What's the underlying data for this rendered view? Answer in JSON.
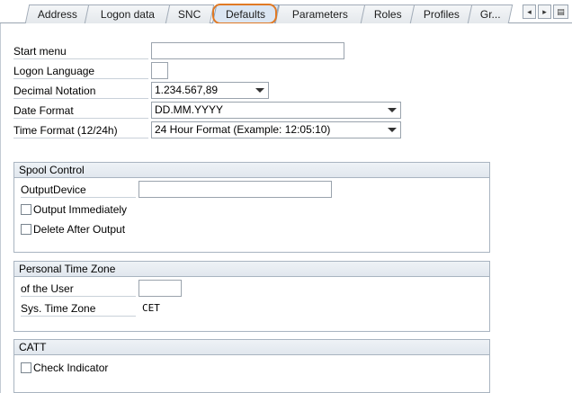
{
  "tabs": [
    "Address",
    "Logon data",
    "SNC",
    "Defaults",
    "Parameters",
    "Roles",
    "Profiles",
    "Gr..."
  ],
  "active_tab": "Defaults",
  "nav": {
    "prev": "◂",
    "next": "▸",
    "menu": "▤"
  },
  "fields": {
    "start_menu": {
      "label": "Start menu",
      "value": ""
    },
    "logon_language": {
      "label": "Logon Language",
      "value": ""
    },
    "decimal_notation": {
      "label": "Decimal Notation",
      "value": "1.234.567,89"
    },
    "date_format": {
      "label": "Date Format",
      "value": "DD.MM.YYYY"
    },
    "time_format": {
      "label": "Time Format (12/24h)",
      "value": "24 Hour Format (Example: 12:05:10)"
    }
  },
  "spool": {
    "title": "Spool Control",
    "output_device_label": "OutputDevice",
    "output_device_value": "",
    "output_immediately": "Output Immediately",
    "delete_after_output": "Delete After Output"
  },
  "timezone": {
    "title": "Personal Time Zone",
    "user_label": "of the User",
    "user_value": "",
    "sys_label": "Sys. Time Zone",
    "sys_value": "CET"
  },
  "catt": {
    "title": "CATT",
    "check_indicator": "Check Indicator"
  }
}
